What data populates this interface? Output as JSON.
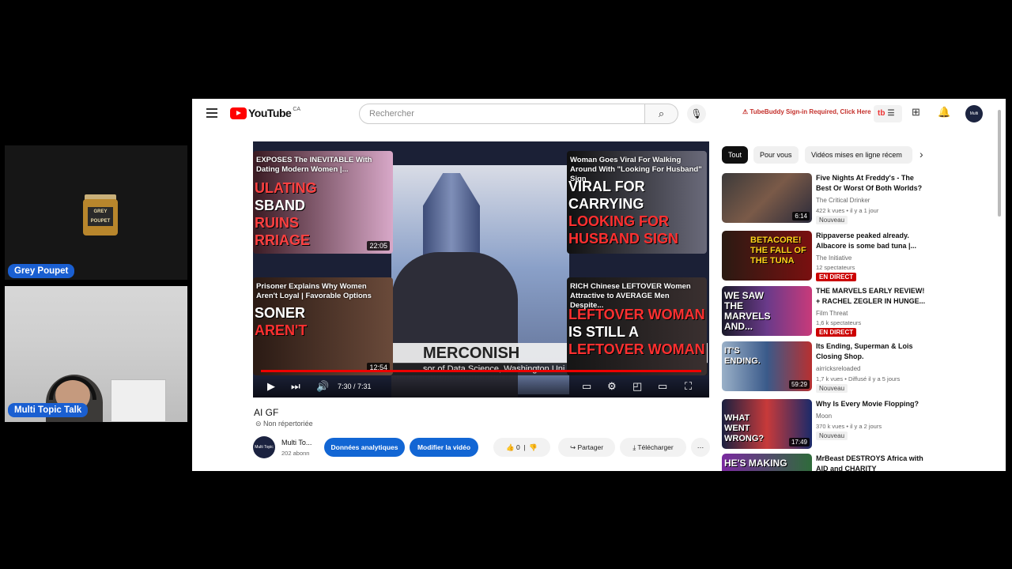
{
  "participants": {
    "top": {
      "name": "Grey Poupet",
      "jar_label": "GREY POUPET"
    },
    "bottom": {
      "name": "Multi Topic Talk"
    }
  },
  "youtube": {
    "region": "CA",
    "logo_text": "YouTube",
    "search_placeholder": "Rechercher",
    "tubebuddy_warning": "⚠ TubeBuddy Sign-in Required, Click Here",
    "tubebuddy_button": "tb",
    "avatar_text": "Multi Topic Talk"
  },
  "player": {
    "endcards": [
      {
        "title": "EXPOSES The INEVITABLE With Dating Modern Women |...",
        "big": [
          "ULATING",
          "SBAND",
          "RUINS",
          "RRIAGE"
        ],
        "duration": "22:05"
      },
      {
        "title": "Woman Goes Viral For Walking Around With \"Looking For Husband\" Sign",
        "big": [
          "VIRAL FOR",
          "CARRYING",
          "LOOKING FOR",
          "HUSBAND SIGN"
        ],
        "duration": ""
      },
      {
        "title": "Prisoner Explains Why Women Aren't Loyal | Favorable Options",
        "big": [
          "SONER",
          "AREN'T"
        ],
        "duration": "12:54"
      },
      {
        "title": "RICH Chinese LEFTOVER Women Attractive to AVERAGE Men Despite...",
        "big": [
          "LEFTOVER WOMAN",
          "IS STILL A",
          "LEFTOVER WOMAN"
        ],
        "duration": ""
      }
    ],
    "lower_third": "MERCONISH",
    "lower_third_sub": "sor of Data Science, Washington Uni",
    "time": "7:30 / 7:31"
  },
  "video": {
    "title": "AI GF",
    "visibility": "Non répertoriée",
    "channel": "Multi To...",
    "subscribers": "202 abonn",
    "analytics_button": "Données analytiques",
    "edit_button": "Modifier la vidéo",
    "likes": "0",
    "share_button": "Partager",
    "download_button": "Télécharger"
  },
  "chips": [
    "Tout",
    "Pour vous",
    "Vidéos mises en ligne récem"
  ],
  "recommendations": [
    {
      "title": "Five Nights At Freddy's - The Best Or Worst Of Both Worlds?",
      "channel": "The Critical Drinker",
      "meta": "422 k vues • il y a 1 jour",
      "badge": "Nouveau",
      "duration": "6:14",
      "thumb_text": "",
      "thumb_color": "#5a4a3c"
    },
    {
      "title": "Rippaverse peaked already. Albacore is some bad tuna |...",
      "channel": "The Initiative",
      "meta": "12 spectateurs",
      "badge": "EN DIRECT",
      "duration": "",
      "thumb_text": "BETACORE! THE FALL OF THE TUNA",
      "thumb_color": "#8a1f1f"
    },
    {
      "title": "THE MARVELS EARLY REVIEW! + RACHEL ZEGLER IN HUNGE...",
      "channel": "Film Threat",
      "meta": "1,6 k spectateurs",
      "badge": "EN DIRECT",
      "duration": "",
      "thumb_text": "WE SAW THE MARVELS AND...",
      "thumb_color": "#3a2a6a"
    },
    {
      "title": "Its Ending, Superman & Lois Closing Shop.",
      "channel": "airricksreloaded",
      "meta": "1,7 k vues • Diffusé il y a 5 jours",
      "badge": "Nouveau",
      "duration": "59:29",
      "thumb_text": "IT'S ENDING.",
      "thumb_color": "#5b7fa8"
    },
    {
      "title": "Why Is Every Movie Flopping?",
      "channel": "Moon",
      "meta": "370 k vues • il y a 2 jours",
      "badge": "Nouveau",
      "duration": "17:49",
      "thumb_text": "WHAT WENT WRONG?",
      "thumb_color": "#1f2a44"
    },
    {
      "title": "MrBeast DESTROYS Africa with AID and CHARITY",
      "channel": "",
      "meta": "",
      "badge": "",
      "duration": "",
      "thumb_text": "HE'S MAKING",
      "thumb_color": "#2e6b3a"
    }
  ]
}
